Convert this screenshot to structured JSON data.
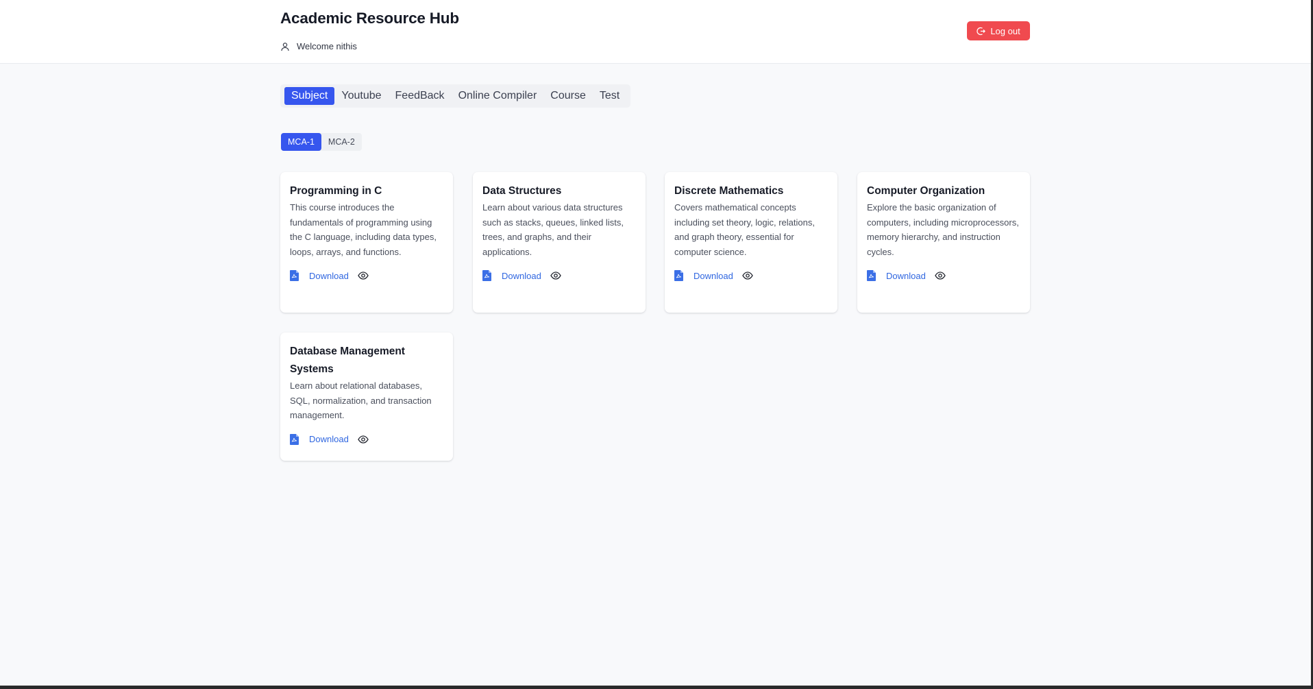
{
  "header": {
    "title": "Academic Resource Hub",
    "welcome_text": "Welcome nithis",
    "logout_label": "Log out"
  },
  "main_tabs": [
    {
      "label": "Subject",
      "active": true
    },
    {
      "label": "Youtube",
      "active": false
    },
    {
      "label": "FeedBack",
      "active": false
    },
    {
      "label": "Online Compiler",
      "active": false
    },
    {
      "label": "Course",
      "active": false
    },
    {
      "label": "Test",
      "active": false
    }
  ],
  "sub_tabs": [
    {
      "label": "MCA-1",
      "active": true
    },
    {
      "label": "MCA-2",
      "active": false
    }
  ],
  "cards": [
    {
      "title": "Programming in C",
      "description": "This course introduces the fundamentals of programming using the C language, including data types, loops, arrays, and functions.",
      "download_label": "Download"
    },
    {
      "title": "Data Structures",
      "description": "Learn about various data structures such as stacks, queues, linked lists, trees, and graphs, and their applications.",
      "download_label": "Download"
    },
    {
      "title": "Discrete Mathematics",
      "description": "Covers mathematical concepts including set theory, logic, relations, and graph theory, essential for computer science.",
      "download_label": "Download"
    },
    {
      "title": "Computer Organization",
      "description": "Explore the basic organization of computers, including microprocessors, memory hierarchy, and instruction cycles.",
      "download_label": "Download"
    },
    {
      "title": "Database Management Systems",
      "description": "Learn about relational databases, SQL, normalization, and transaction management.",
      "download_label": "Download"
    }
  ],
  "icons": {
    "user": "user-icon",
    "logout": "logout-icon",
    "document": "pdf-document-icon",
    "view": "eye-icon"
  },
  "colors": {
    "accent": "#3656ee",
    "logout": "#f04a4f",
    "link": "#2f66e0"
  }
}
